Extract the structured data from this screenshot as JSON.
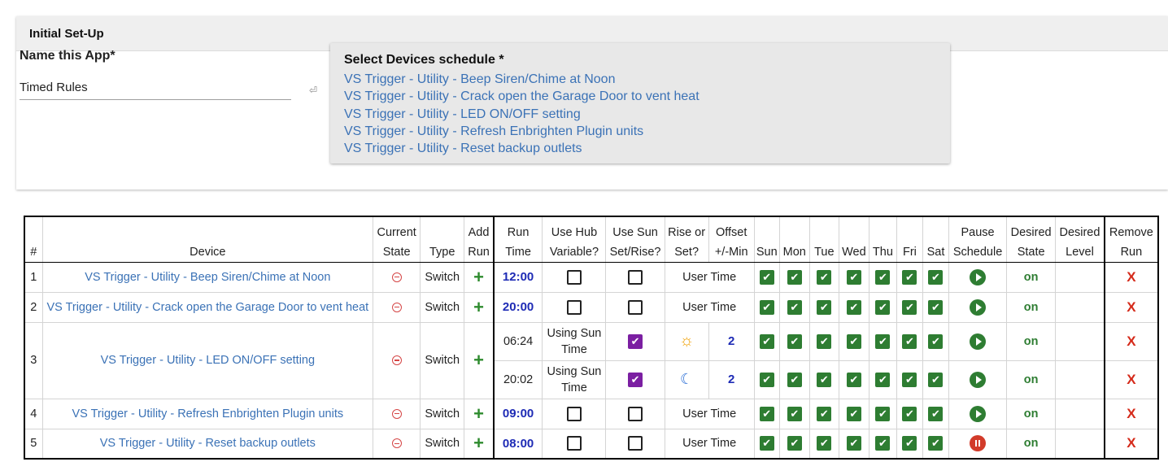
{
  "section": {
    "title": "Initial Set-Up"
  },
  "app_name": {
    "label": "Name this App*",
    "value": "Timed Rules"
  },
  "devices_select": {
    "title": "Select Devices schedule *",
    "items": [
      "VS Trigger - Utility - Beep Siren/Chime at Noon",
      "VS Trigger - Utility - Crack open the Garage Door to vent heat",
      "VS Trigger - Utility - LED ON/OFF setting",
      "VS Trigger - Utility - Refresh Enbrighten Plugin units",
      "VS Trigger - Utility - Reset backup outlets"
    ]
  },
  "table": {
    "headers": {
      "num": "#",
      "device": "Device",
      "current_state": "Current State",
      "type": "Type",
      "add_run": "Add Run",
      "run_time": "Run Time",
      "use_hub": "Use Hub Variable?",
      "use_sun": "Use Sun Set/Rise?",
      "rise_set": "Rise or Set?",
      "offset": "Offset +/-Min",
      "days": [
        "Sun",
        "Mon",
        "Tue",
        "Wed",
        "Thu",
        "Fri",
        "Sat"
      ],
      "pause": "Pause Schedule",
      "desired_state": "Desired State",
      "desired_level": "Desired Level",
      "remove": "Remove Run"
    },
    "rows": [
      {
        "num": "1",
        "device": "VS Trigger - Utility - Beep Siren/Chime at Noon",
        "type": "Switch",
        "add": "+",
        "runs": [
          {
            "time": "12:00",
            "use_hub": false,
            "use_sun": false,
            "time_mode": "User Time",
            "days": [
              true,
              true,
              true,
              true,
              true,
              true,
              true
            ],
            "paused": false,
            "state": "on",
            "level": "",
            "remove": "X"
          }
        ]
      },
      {
        "num": "2",
        "device": "VS Trigger - Utility - Crack open the Garage Door to vent heat",
        "type": "Switch",
        "add": "+",
        "runs": [
          {
            "time": "20:00",
            "use_hub": false,
            "use_sun": false,
            "time_mode": "User Time",
            "days": [
              true,
              true,
              true,
              true,
              true,
              true,
              true
            ],
            "paused": false,
            "state": "on",
            "level": "",
            "remove": "X"
          }
        ]
      },
      {
        "num": "3",
        "device": "VS Trigger - Utility - LED ON/OFF setting",
        "type": "Switch",
        "add": "+",
        "runs": [
          {
            "time": "06:24",
            "hub_text": "Using Sun Time",
            "use_sun": true,
            "rise_set": "sunrise",
            "offset": "2",
            "days": [
              true,
              true,
              true,
              true,
              true,
              true,
              true
            ],
            "paused": false,
            "state": "on",
            "level": "",
            "remove": "X"
          },
          {
            "time": "20:02",
            "hub_text": "Using Sun Time",
            "use_sun": true,
            "rise_set": "sunset",
            "offset": "2",
            "days": [
              true,
              true,
              true,
              true,
              true,
              true,
              true
            ],
            "paused": false,
            "state": "on",
            "level": "",
            "remove": "X"
          }
        ]
      },
      {
        "num": "4",
        "device": "VS Trigger - Utility - Refresh Enbrighten Plugin units",
        "type": "Switch",
        "add": "+",
        "runs": [
          {
            "time": "09:00",
            "use_hub": false,
            "use_sun": false,
            "time_mode": "User Time",
            "days": [
              true,
              true,
              true,
              true,
              true,
              true,
              true
            ],
            "paused": false,
            "state": "on",
            "level": "",
            "remove": "X"
          }
        ]
      },
      {
        "num": "5",
        "device": "VS Trigger - Utility - Reset backup outlets",
        "type": "Switch",
        "add": "+",
        "runs": [
          {
            "time": "08:00",
            "use_hub": false,
            "use_sun": false,
            "time_mode": "User Time",
            "days": [
              true,
              true,
              true,
              true,
              true,
              true,
              true
            ],
            "paused": true,
            "state": "on",
            "level": "",
            "remove": "X"
          }
        ]
      }
    ]
  }
}
